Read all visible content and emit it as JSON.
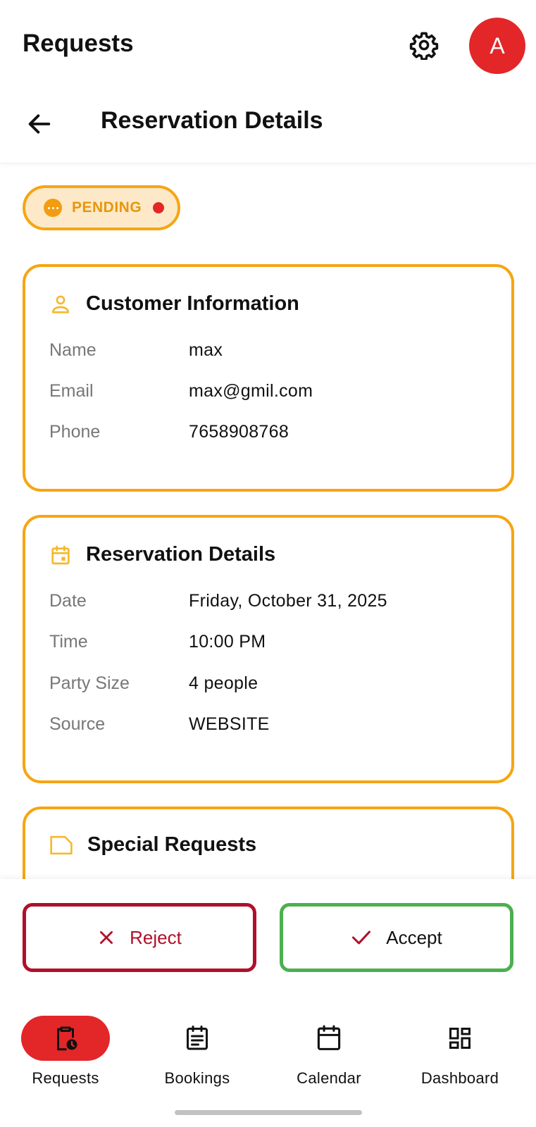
{
  "header": {
    "title": "Requests",
    "avatar_letter": "A"
  },
  "subheader": {
    "title": "Reservation Details"
  },
  "status": {
    "label": "PENDING",
    "color": "#f6a513"
  },
  "customer": {
    "title": "Customer Information",
    "rows": [
      {
        "label": "Name",
        "value": "max"
      },
      {
        "label": "Email",
        "value": "max@gmil.com"
      },
      {
        "label": "Phone",
        "value": "7658908768"
      }
    ]
  },
  "reservation": {
    "title": "Reservation Details",
    "rows": [
      {
        "label": "Date",
        "value": "Friday, October 31, 2025"
      },
      {
        "label": "Time",
        "value": "10:00 PM"
      },
      {
        "label": "Party Size",
        "value": "4 people"
      },
      {
        "label": "Source",
        "value": "WEBSITE"
      }
    ]
  },
  "special": {
    "title": "Special Requests"
  },
  "actions": {
    "reject_label": "Reject",
    "accept_label": "Accept"
  },
  "nav": {
    "items": [
      {
        "label": "Requests",
        "icon": "clipboard-clock-icon",
        "active": true
      },
      {
        "label": "Bookings",
        "icon": "list-icon",
        "active": false
      },
      {
        "label": "Calendar",
        "icon": "calendar-icon",
        "active": false
      },
      {
        "label": "Dashboard",
        "icon": "dashboard-icon",
        "active": false
      }
    ]
  },
  "colors": {
    "accent": "#e32628",
    "card_border": "#f6a513",
    "reject": "#b0102a",
    "accept": "#4caf50"
  }
}
